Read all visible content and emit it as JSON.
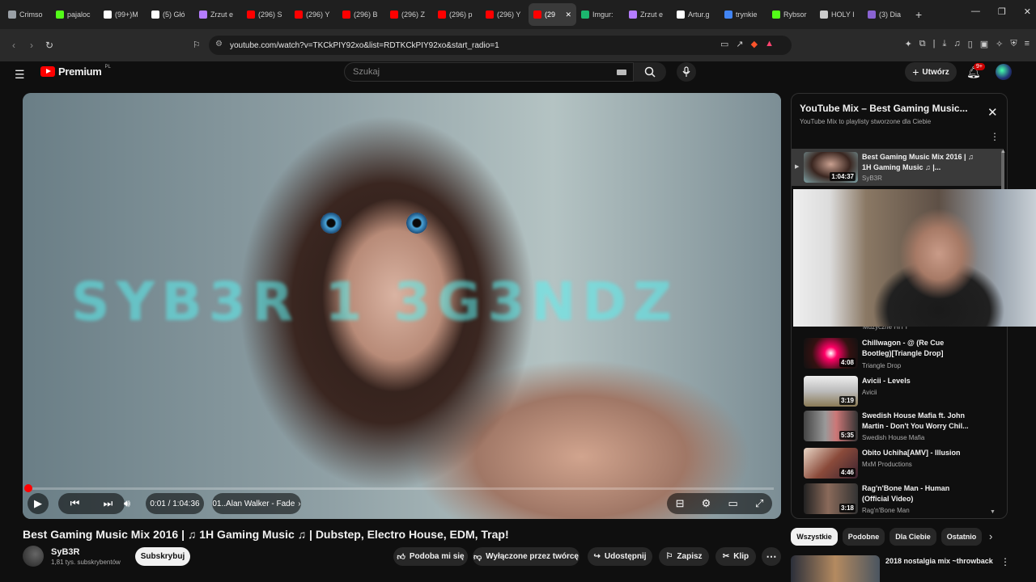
{
  "browser": {
    "tabs": [
      {
        "label": "Crimso",
        "color": "#9aa0a6"
      },
      {
        "label": "pajaloc",
        "color": "#53fc18"
      },
      {
        "label": "(99+)M",
        "color": "#ffffff"
      },
      {
        "label": "(5) Głó",
        "color": "#ffffff"
      },
      {
        "label": "Zrzut e",
        "color": "#b57cff"
      },
      {
        "label": "(296) S",
        "color": "#ff0000"
      },
      {
        "label": "(296) Y",
        "color": "#ff0000"
      },
      {
        "label": "(296) B",
        "color": "#ff0000"
      },
      {
        "label": "(296) Z",
        "color": "#ff0000"
      },
      {
        "label": "(296) p",
        "color": "#ff0000"
      },
      {
        "label": "(296) Y",
        "color": "#ff0000"
      },
      {
        "label": "(29",
        "color": "#ff0000"
      },
      {
        "label": "Imgur:",
        "color": "#1bb76e"
      },
      {
        "label": "Zrzut e",
        "color": "#b57cff"
      },
      {
        "label": "Artur.g",
        "color": "#ffffff"
      },
      {
        "label": "trynkie",
        "color": "#4285f4"
      },
      {
        "label": "Rybsor",
        "color": "#53fc18"
      },
      {
        "label": "HOLY I",
        "color": "#cccccc"
      },
      {
        "label": "(3) Dia",
        "color": "#8a63d2"
      }
    ],
    "active_tab_index": 11,
    "new_tab": "+",
    "url": "youtube.com/watch?v=TKCkPIY92xo&list=RDTKCkPIY92xo&start_radio=1"
  },
  "header": {
    "logo_text": "Premium",
    "logo_region": "PL",
    "search_placeholder": "Szukaj",
    "create_label": "Utwórz",
    "notif_badge": "9+"
  },
  "player": {
    "watermark": "SYB3R 1 3G3NDZ",
    "time_current": "0:01",
    "time_total": "1:04:36",
    "time_sep": " / ",
    "chapter": "01..Alan Walker - Fade",
    "progress_percent": 0.1
  },
  "video": {
    "title": "Best Gaming Music Mix 2016 | ♫ 1H Gaming Music ♫ | Dubstep, Electro House, EDM, Trap!",
    "channel": "SyB3R",
    "subscribers": "1,81 tys. subskrybentów",
    "subscribe_label": "Subskrybuj",
    "actions": {
      "like": "Podoba mi się",
      "dislike": "Wyłączone przez twórcę",
      "share": "Udostępnij",
      "save": "Zapisz",
      "clip": "Klip"
    }
  },
  "playlist": {
    "title": "YouTube Mix – Best Gaming Music...",
    "subtitle": "YouTube Mix to playlisty stworzone dla Ciebie",
    "hidden_channel": "Muzyczne HITY",
    "items": [
      {
        "title": "Best Gaming Music Mix 2016 | ♫ 1H Gaming Music ♫ |...",
        "channel": "SyB3R",
        "duration": "1:04:37"
      },
      {
        "title": "Chillwagon - @ (Re Cue Bootleg)[Triangle Drop]",
        "channel": "Triangle Drop",
        "duration": "4:08"
      },
      {
        "title": "Avicii - Levels",
        "channel": "Avicii",
        "duration": "3:19"
      },
      {
        "title": "Swedish House Mafia ft. John Martin - Don't You Worry Chil...",
        "channel": "Swedish House Mafia",
        "duration": "5:35"
      },
      {
        "title": "Obito Uchiha[AMV] - Illusion",
        "channel": "MxM Productions",
        "duration": "4:46"
      },
      {
        "title": "Rag'n'Bone Man - Human (Official Video)",
        "channel": "Rag'n'Bone Man",
        "duration": "3:18"
      }
    ]
  },
  "chips": [
    "Wszystkie",
    "Podobne",
    "Dla Ciebie",
    "Ostatnio"
  ],
  "recommendation": {
    "title": "2018 nostalgia mix ~throwback"
  }
}
